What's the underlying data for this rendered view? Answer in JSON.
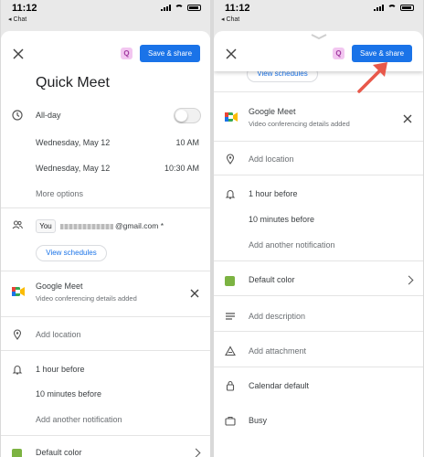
{
  "status": {
    "time": "11:12",
    "back": "◂ Chat"
  },
  "left": {
    "close_glyph": "✕",
    "avatar": "Q",
    "save_label": "Save & share",
    "title": "Quick Meet",
    "allday_label": "All-day",
    "start_date": "Wednesday, May 12",
    "start_time": "10 AM",
    "end_date": "Wednesday, May 12",
    "end_time": "10:30 AM",
    "more_options": "More options",
    "you_chip": "You",
    "email_suffix": "@gmail.com *",
    "view_schedules": "View schedules",
    "meet_title": "Google Meet",
    "meet_sub": "Video conferencing details added",
    "add_location": "Add location",
    "notif1": "1 hour before",
    "notif2": "10 minutes before",
    "add_notif": "Add another notification",
    "default_color": "Default color"
  },
  "right": {
    "avatar": "Q",
    "save_label": "Save & share",
    "view_schedules": "View schedules",
    "meet_title": "Google Meet",
    "meet_sub": "Video conferencing details added",
    "add_location": "Add location",
    "notif1": "1 hour before",
    "notif2": "10 minutes before",
    "add_notif": "Add another notification",
    "default_color": "Default color",
    "add_description": "Add description",
    "add_attachment": "Add attachment",
    "calendar_default": "Calendar default",
    "busy": "Busy"
  },
  "colors": {
    "accent": "#1a73e8",
    "event_green": "#7cb342",
    "arrow_red": "#e8584a"
  },
  "icons": [
    "close-icon",
    "clock-icon",
    "people-icon",
    "google-meet-icon",
    "location-pin-icon",
    "bell-icon",
    "color-square-icon",
    "description-icon",
    "attachment-icon",
    "lock-icon",
    "briefcase-icon",
    "chevron-right-icon"
  ]
}
